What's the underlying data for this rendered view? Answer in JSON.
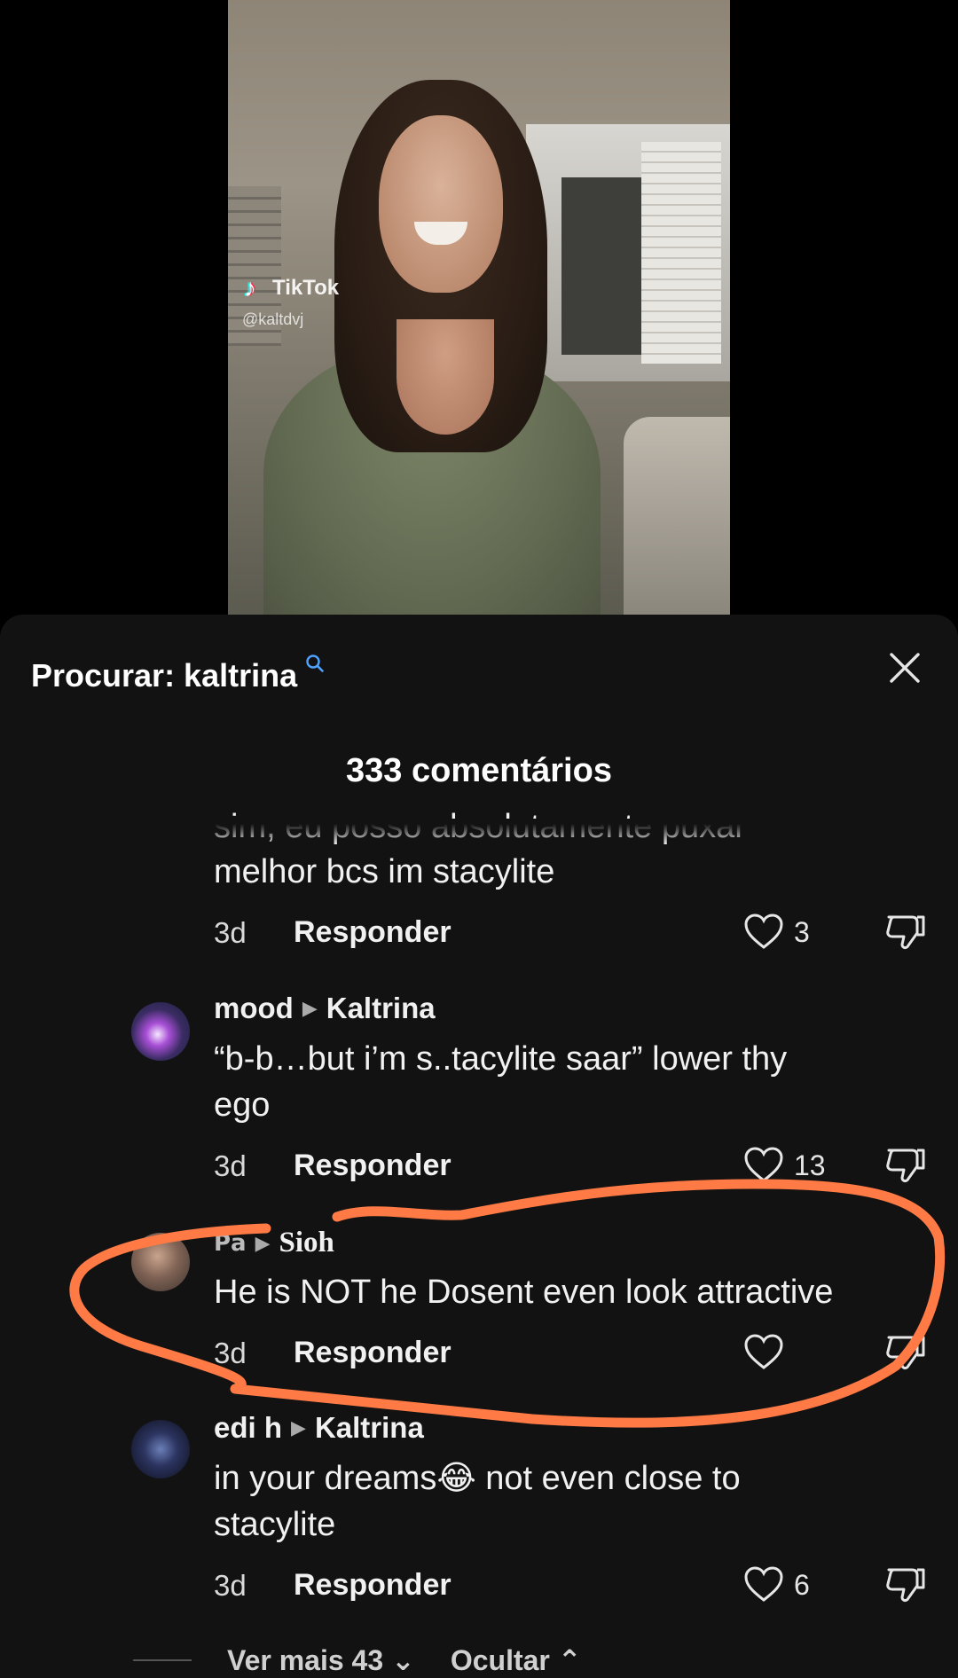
{
  "video": {
    "watermark_brand": "TikTok",
    "watermark_handle": "@kaltdvj"
  },
  "search": {
    "label": "Procurar: kaltrina"
  },
  "comments_count": "333 comentários",
  "comments": [
    {
      "partial_line": "sim, eu posso absolutamente puxar",
      "text": "melhor bcs im stacylite",
      "age": "3d",
      "reply_label": "Responder",
      "likes": "3"
    },
    {
      "author": "mood",
      "reply_to": "Kaltrina",
      "line1": "“b-b…but i’m s..tacylite saar” lower thy",
      "line2": "ego",
      "age": "3d",
      "reply_label": "Responder",
      "likes": "13"
    },
    {
      "author_prefix": "𝗣𝗮",
      "author": "Sioh",
      "line1": "He is NOT he Dosent even look attractive",
      "age": "3d",
      "reply_label": "Responder",
      "likes": ""
    },
    {
      "author": "edi h",
      "reply_to": "Kaltrina",
      "line1": "in your dreams😂 not even close to",
      "line2": "stacylite",
      "age": "3d",
      "reply_label": "Responder",
      "likes": "6"
    }
  ],
  "footer": {
    "view_more": "Ver mais 43",
    "hide": "Ocultar"
  },
  "colors": {
    "sheet_bg": "#121212",
    "annotation": "#ff7a45",
    "search_icon": "#4da3ff"
  }
}
